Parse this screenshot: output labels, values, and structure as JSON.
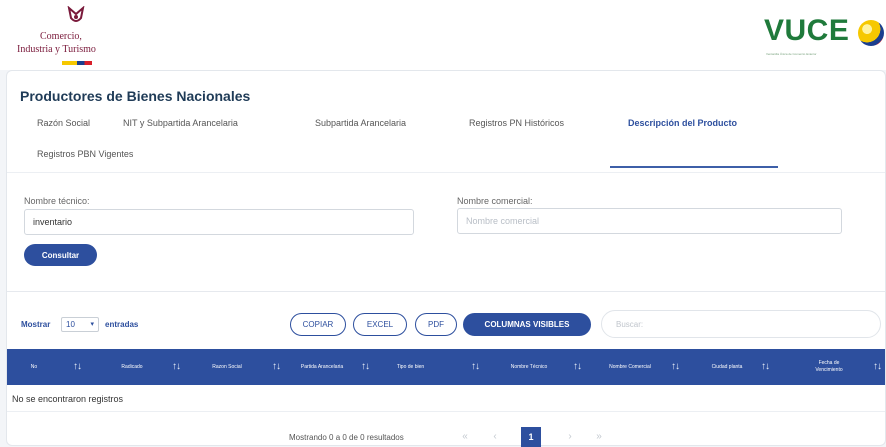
{
  "header": {
    "ministry_line1": "Comercio,",
    "ministry_line2": "Industria y Turismo",
    "vuce_logo": "VUCE",
    "vuce_tagline": "Ventanilla Única de Comercio Exterior"
  },
  "page": {
    "title": "Productores de Bienes Nacionales",
    "tabs": [
      {
        "label": "Razón Social"
      },
      {
        "label": "NIT y Subpartida Arancelaria"
      },
      {
        "label": "Subpartida Arancelaria"
      },
      {
        "label": "Registros PN Históricos"
      },
      {
        "label": "Descripción del Producto"
      },
      {
        "label": "Registros PBN Vigentes"
      }
    ],
    "active_tab": "Descripción del Producto"
  },
  "form": {
    "tecnico_label": "Nombre técnico:",
    "tecnico_value": "inventario",
    "comercial_label": "Nombre comercial:",
    "comercial_placeholder": "Nombre comercial",
    "submit_label": "Consultar"
  },
  "table_controls": {
    "show_prefix": "Mostrar",
    "page_length": "10",
    "show_suffix": "entradas",
    "buttons": [
      "COPIAR",
      "EXCEL",
      "PDF",
      "COLUMNAS VISIBLES"
    ],
    "search_placeholder": "Buscar:"
  },
  "table": {
    "columns": [
      "No",
      "Radicado",
      "Razon Social",
      "Partida Arancelaria",
      "Tipo de bien",
      "Nombre Técnico",
      "Nombre Comercial",
      "Ciudad planta",
      "Fecha de Vencimiento"
    ],
    "sort_icon": "↑↓",
    "empty_message": "No se encontraron registros"
  },
  "pagination": {
    "info": "Mostrando 0 a 0 de 0 resultados",
    "first": "«",
    "prev": "‹",
    "current": "1",
    "next": "›",
    "last": "»"
  },
  "colors": {
    "primary": "#2d4f9e",
    "title": "#1f3b57",
    "ministry": "#7a1a3b",
    "vuce_green": "#1f7a3b"
  }
}
